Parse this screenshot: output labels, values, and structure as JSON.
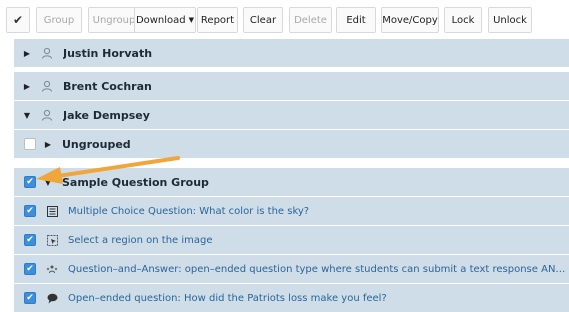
{
  "toolbar": {
    "check_glyph": "✔",
    "group": "Group",
    "ungroup": "Ungroup",
    "download": "Download",
    "report": "Report",
    "clear": "Clear",
    "delete": "Delete",
    "edit": "Edit",
    "move_copy": "Move/Copy",
    "lock": "Lock",
    "unlock": "Unlock"
  },
  "students": [
    {
      "name": "Justin Horvath",
      "expanded": false
    },
    {
      "name": "Brent Cochran",
      "expanded": false
    },
    {
      "name": "Jake Dempsey",
      "expanded": true
    }
  ],
  "ungrouped": {
    "label": "Ungrouped",
    "checked": false
  },
  "group": {
    "label": "Sample Question Group",
    "checked": true
  },
  "questions": [
    {
      "icon": "list-icon",
      "text": "Multiple Choice Question: What color is the sky?",
      "checked": true
    },
    {
      "icon": "region-select-icon",
      "text": "Select a region on the image",
      "checked": true
    },
    {
      "icon": "qa-vote-icon",
      "text": "Question–and–Answer: open–ended question type where students can submit a text response AND \"vote\" on their cl...",
      "checked": true
    },
    {
      "icon": "speech-bubble-icon",
      "text": "Open–ended question: How did the Patriots loss make you feel?",
      "checked": true
    }
  ],
  "colors": {
    "row_bg": "#cfdde8",
    "link_blue": "#2a6599",
    "checkbox_blue": "#3c8fdc",
    "arrow_orange": "#f0a63a"
  }
}
